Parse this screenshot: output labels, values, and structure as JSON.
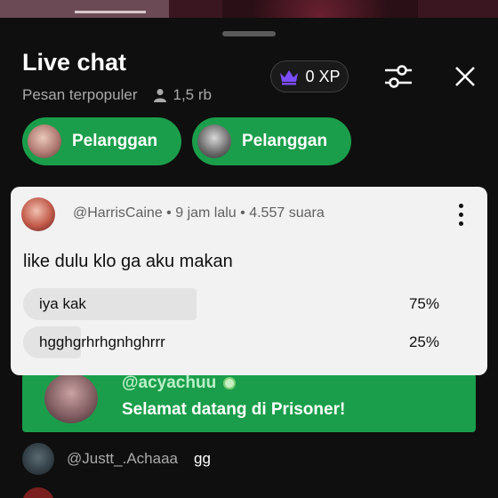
{
  "header": {
    "title": "Live chat",
    "subtitle": "Pesan terpopuler",
    "viewer_count": "1,5 rb",
    "xp_label": "0 XP"
  },
  "membership_chips": [
    {
      "label": "Pelanggan"
    },
    {
      "label": "Pelanggan"
    }
  ],
  "poll": {
    "author": "@HarrisCaine",
    "time": "9 jam lalu",
    "votes": "4.557 suara",
    "question": "like dulu klo ga aku makan",
    "options": [
      {
        "label": "iya kak",
        "percent_text": "75%",
        "percent": 75
      },
      {
        "label": "hgghgrhrhgnhghrrr",
        "percent_text": "25%",
        "percent": 25
      }
    ]
  },
  "welcome": {
    "username": "@acyachuu",
    "message": "Selamat datang di Prisoner!"
  },
  "messages": [
    {
      "author": "@Justt_.Achaaa",
      "text": "gg"
    }
  ],
  "colors": {
    "accent_green": "#1b9e4b",
    "background": "#0f0f0f",
    "poll_card": "#f2f2f2",
    "crown": "#7c4dff"
  },
  "icons": {
    "viewers": "person-icon",
    "xp": "crown-icon",
    "filter": "sliders-icon",
    "close": "close-icon",
    "more": "more-vert-icon"
  }
}
